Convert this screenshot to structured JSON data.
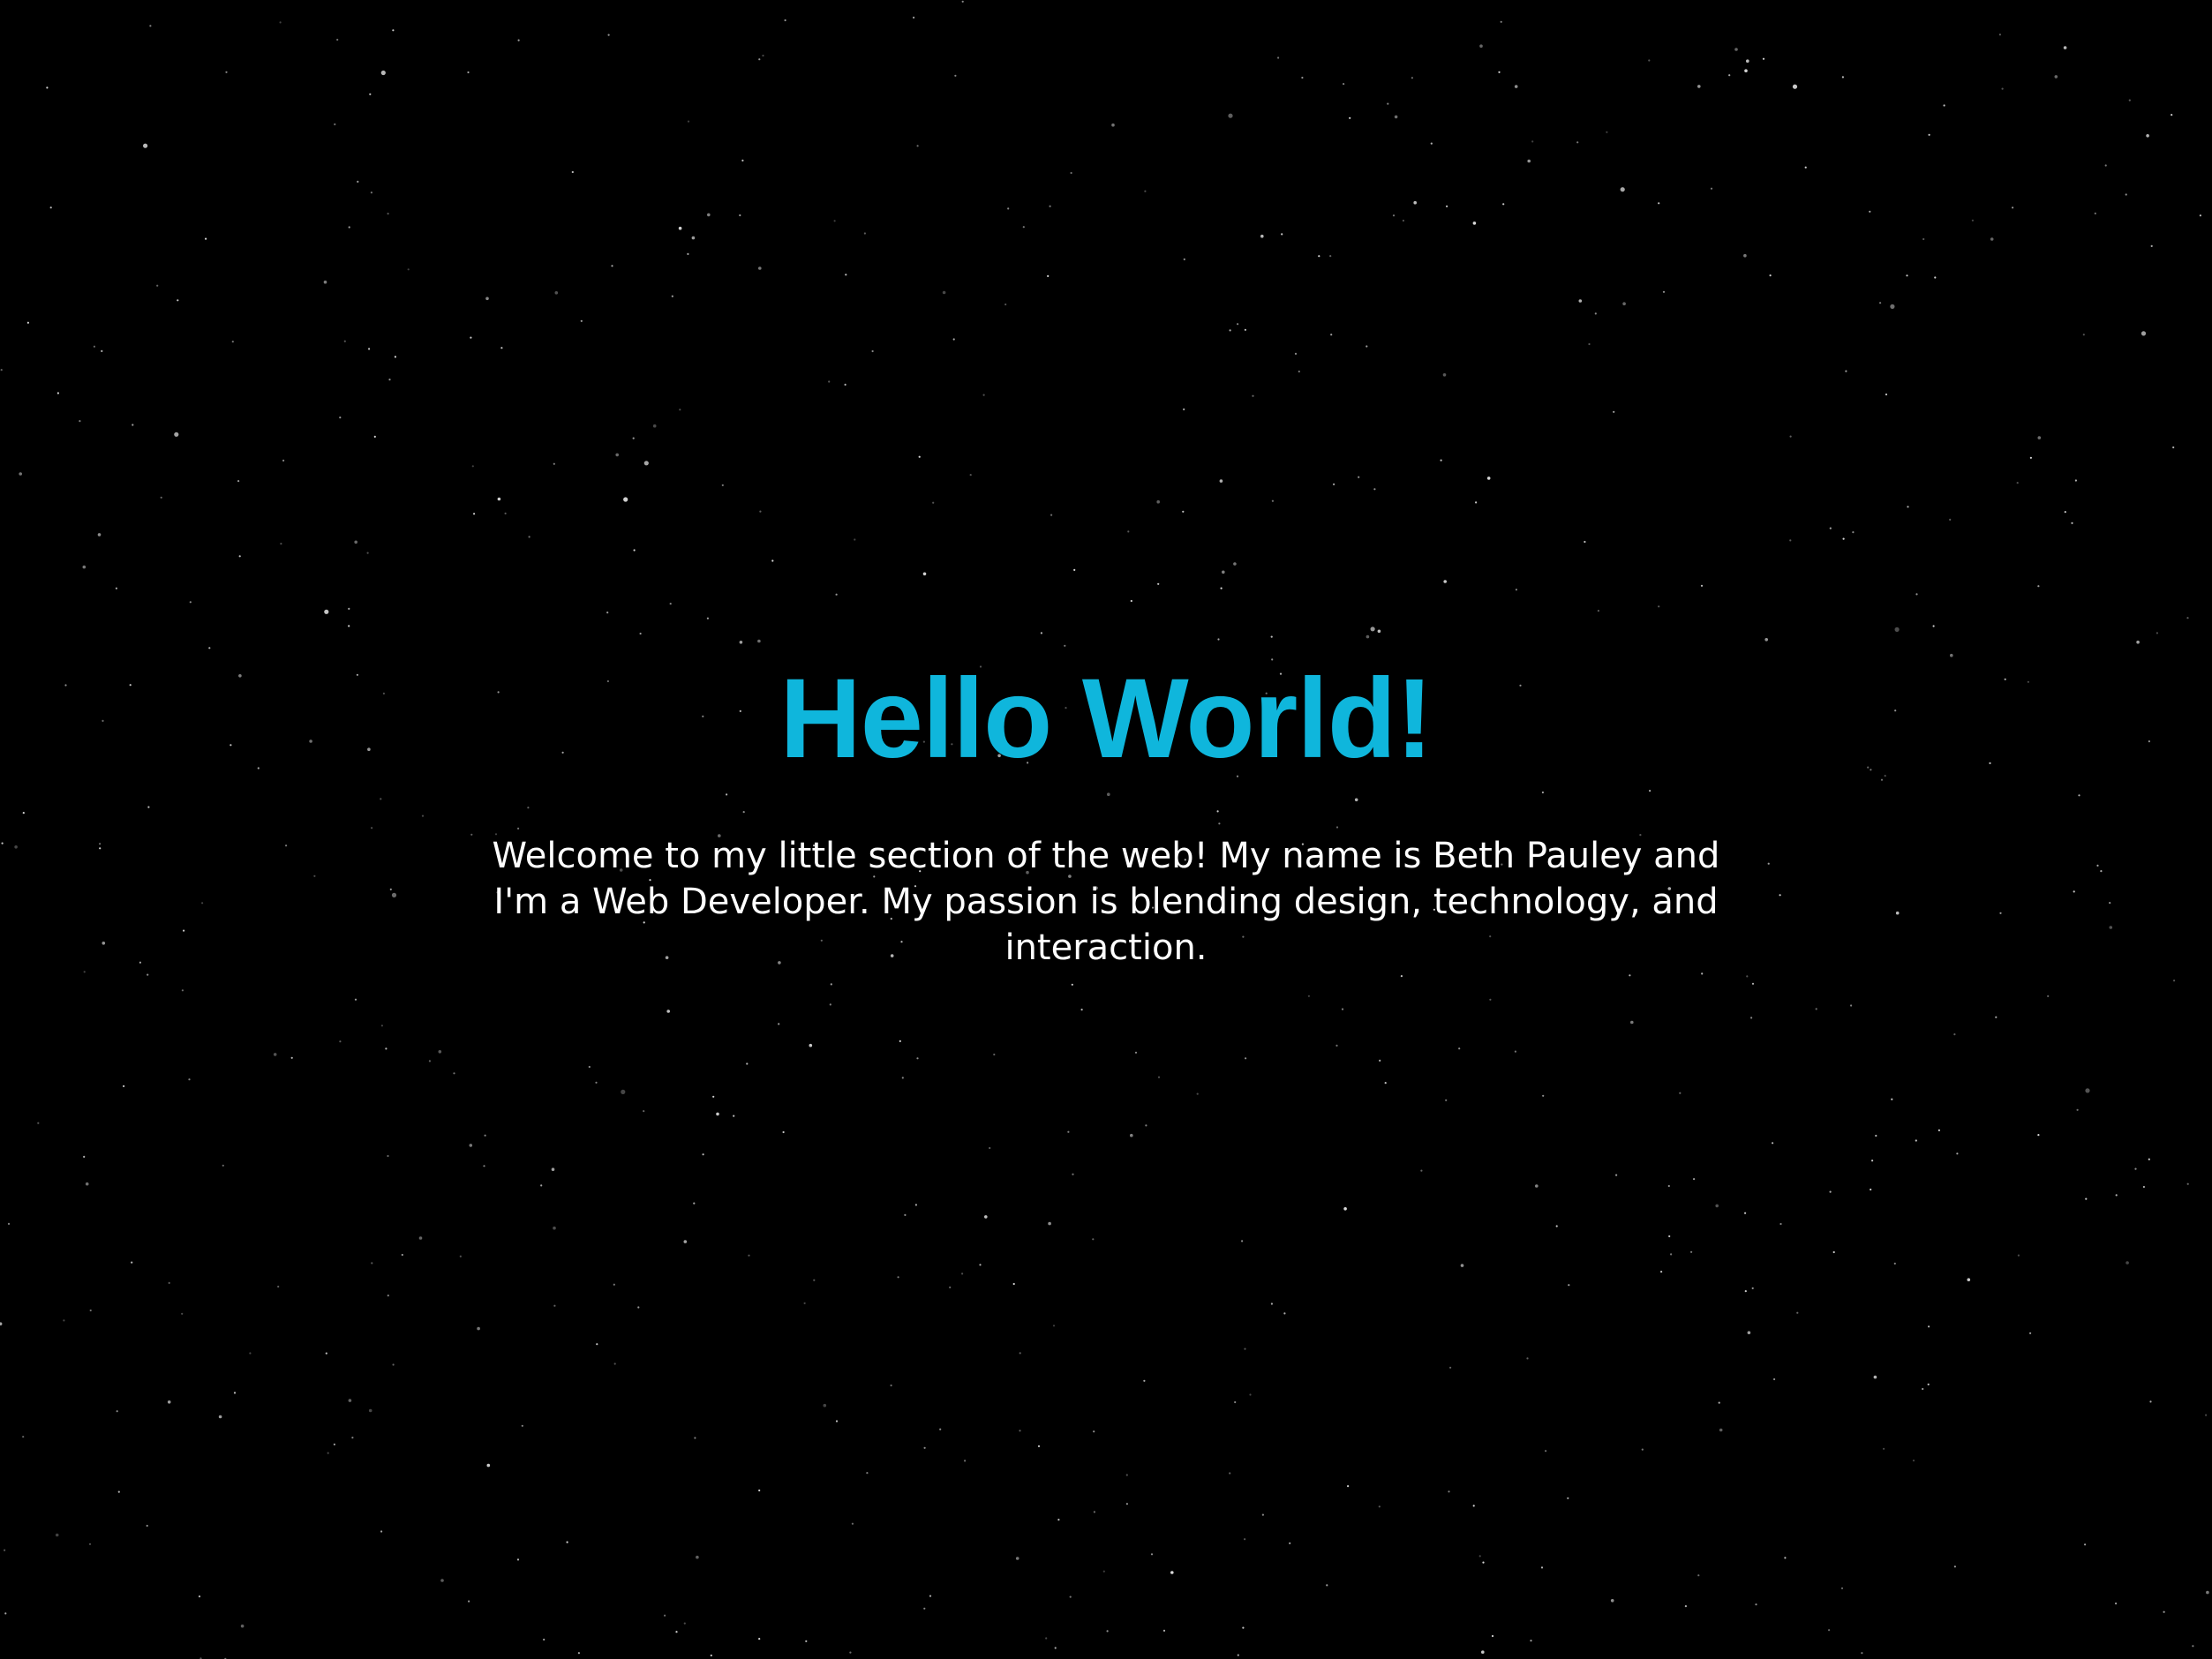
{
  "hero": {
    "heading": "Hello World!",
    "intro": "Welcome to my little section of the web! My name is Beth Pauley and I'm a Web Developer. My passion is blending design, technology, and interaction."
  },
  "colors": {
    "background": "#000000",
    "heading": "#0fb6dc",
    "text": "#ffffff",
    "stars": "#ffffff"
  }
}
